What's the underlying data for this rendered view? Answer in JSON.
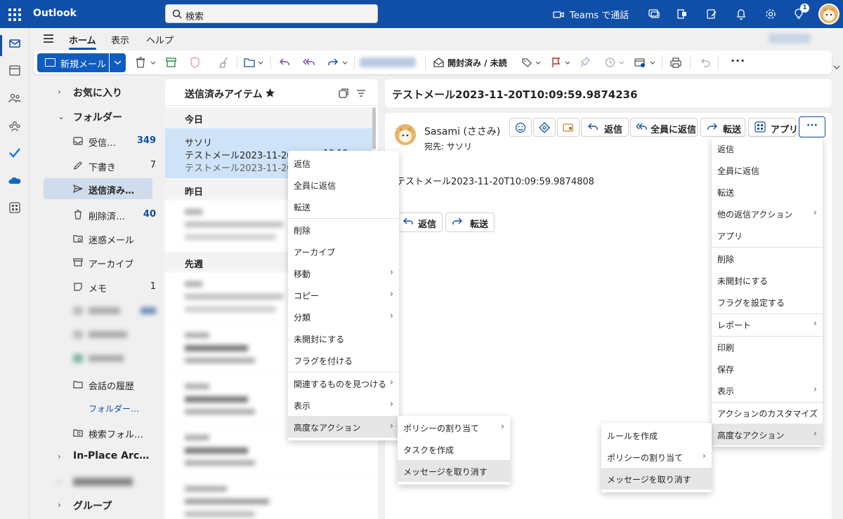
{
  "app": {
    "name": "Outlook",
    "teams_label": "Teams で通話",
    "notification_count": "1"
  },
  "search": {
    "placeholder": "検索"
  },
  "ribbon": {
    "tabs": [
      "ホーム",
      "表示",
      "ヘルプ"
    ],
    "new_mail": "新規メール",
    "read_unread": "開封済み / 未読"
  },
  "folders": {
    "favorites": "お気に入り",
    "folders_label": "フォルダー",
    "items": [
      {
        "label": "受信…",
        "count": "349"
      },
      {
        "label": "下書き",
        "count": "7"
      },
      {
        "label": "送信済み…",
        "count": ""
      },
      {
        "label": "削除済…",
        "count": "40"
      },
      {
        "label": "迷惑メール",
        "count": ""
      },
      {
        "label": "アーカイブ",
        "count": ""
      },
      {
        "label": "メモ",
        "count": "1"
      },
      {
        "label": "会話の履歴",
        "count": ""
      },
      {
        "label": "フォルダー…",
        "count": ""
      },
      {
        "label": "検索フォル…",
        "count": ""
      }
    ],
    "in_place": "In-Place Arc…",
    "groups": "グループ"
  },
  "message_list": {
    "title": "送信済みアイテム",
    "groups": [
      "今日",
      "昨日",
      "先週"
    ],
    "selected": {
      "from": "サソリ",
      "subject": "テストメール2023-11-20T10:…",
      "time": "10:10",
      "preview": "テストメール2023-11-20T1…"
    }
  },
  "reading": {
    "subject": "テストメール2023-11-20T10:09:59.9874236",
    "sender": "Sasami (ささみ)",
    "to": "宛先: サソリ",
    "body": "テストメール2023-11-20T10:09:59.9874808",
    "buttons": {
      "reply": "返信",
      "reply_all": "全員に返信",
      "forward": "転送",
      "apps": "アプリ"
    },
    "more": "···"
  },
  "context_menu": {
    "items": [
      "返信",
      "全員に返信",
      "転送",
      "削除",
      "アーカイブ",
      "移動",
      "コピー",
      "分類",
      "未開封にする",
      "フラグを付ける",
      "関連するものを見つける",
      "表示",
      "高度なアクション"
    ]
  },
  "context_submenu": {
    "items": [
      "ポリシーの割り当て",
      "タスクを作成",
      "メッセージを取り消す"
    ]
  },
  "more_menu": {
    "items": [
      "返信",
      "全員に返信",
      "転送",
      "他の返信アクション",
      "アプリ",
      "削除",
      "未開封にする",
      "フラグを設定する",
      "レポート",
      "印刷",
      "保存",
      "表示",
      "アクションのカスタマイズ",
      "高度なアクション"
    ]
  },
  "more_submenu": {
    "items": [
      "ルールを作成",
      "ポリシーの割り当て",
      "メッセージを取り消す"
    ]
  },
  "colors": {
    "brand": "#0f4fa8",
    "selected_row": "#cfe3f8",
    "selected_folder": "#cfdcec"
  }
}
